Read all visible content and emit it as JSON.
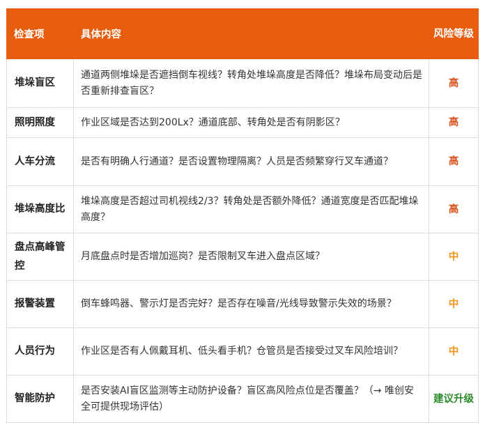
{
  "header": {
    "item": "检查项",
    "content": "具体内容",
    "level": "风险等级"
  },
  "colors": {
    "header_bg": "#e85c0d",
    "high": "#d9531e",
    "medium": "#f0941a",
    "upgrade": "#2e8b2e"
  },
  "rows": [
    {
      "item": "堆垛盲区",
      "content": "通道两侧堆垛是否遮挡倒车视线？转角处堆垛高度是否降低？堆垛布局变动后是否重新排查盲区？",
      "level": "高"
    },
    {
      "item": "照明照度",
      "content": "作业区域是否达到200Lx？通道底部、转角处是否有阴影区？",
      "level": "高"
    },
    {
      "item": "人车分流",
      "content": "是否有明确人行通道？是否设置物理隔离？人员是否频繁穿行叉车通道？",
      "level": "高"
    },
    {
      "item": "堆垛高度比",
      "content": "堆垛高度是否超过司机视线2/3？转角处是否额外降低？通道宽度是否匹配堆垛高度？",
      "level": "高"
    },
    {
      "item": "盘点高峰管控",
      "content": "月底盘点时是否增加巡岗？是否限制叉车进入盘点区域？",
      "level": "中"
    },
    {
      "item": "报警装置",
      "content": "倒车蜂鸣器、警示灯是否完好？是否存在噪音/光线导致警示失效的场景？",
      "level": "中"
    },
    {
      "item": "人员行为",
      "content": "作业区是否有人佩戴耳机、低头看手机？仓管员是否接受过叉车风险培训？",
      "level": "中"
    },
    {
      "item": "智能防护",
      "content": "是否安装AI盲区监测等主动防护设备？盲区高风险点位是否覆盖？（→ 唯创安全可提供现场评估）",
      "level": "建议升级"
    }
  ]
}
